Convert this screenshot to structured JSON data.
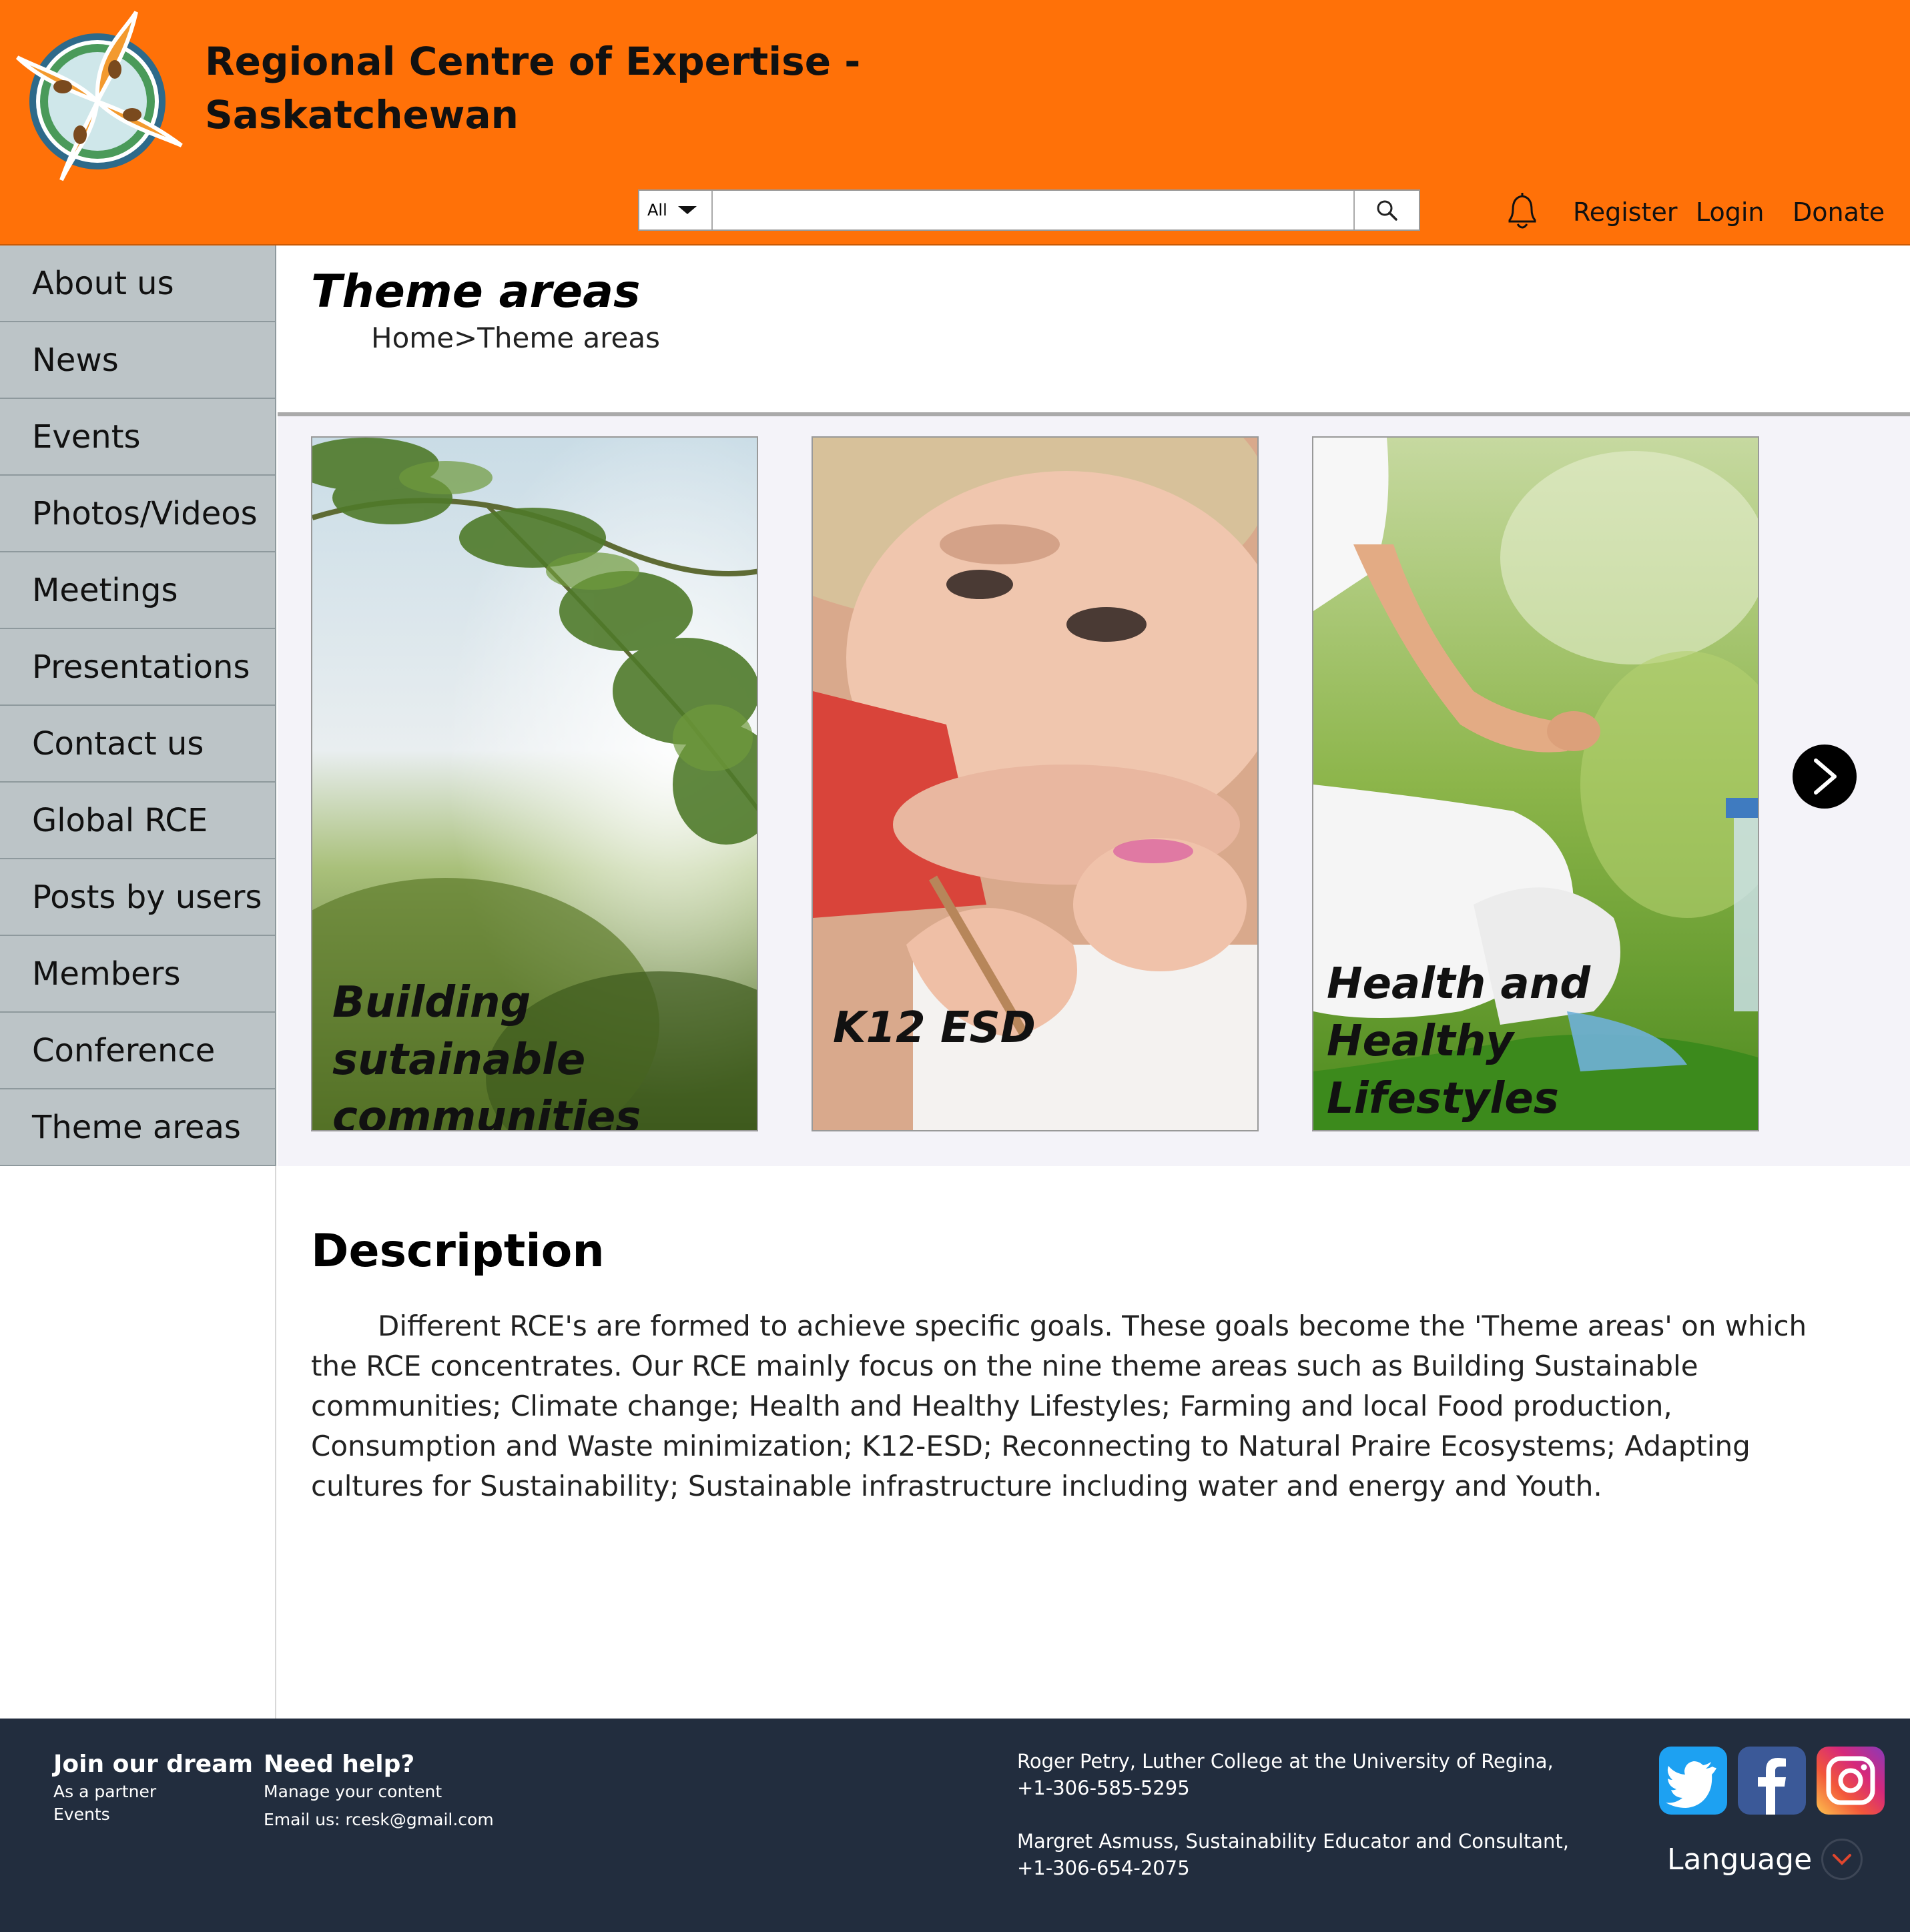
{
  "header": {
    "title_line1": "Regional Centre of Expertise -",
    "title_line2": "Saskatchewan",
    "search": {
      "scope": "All",
      "placeholder": ""
    },
    "links": {
      "register": "Register",
      "login": "Login",
      "donate": "Donate"
    }
  },
  "sidebar": {
    "items": [
      {
        "label": "About us"
      },
      {
        "label": "News"
      },
      {
        "label": "Events"
      },
      {
        "label": "Photos/Videos"
      },
      {
        "label": "Meetings"
      },
      {
        "label": "Presentations"
      },
      {
        "label": "Contact us"
      },
      {
        "label": "Global RCE"
      },
      {
        "label": "Posts by users"
      },
      {
        "label": "Members"
      },
      {
        "label": "Conference"
      },
      {
        "label": "Theme areas"
      }
    ]
  },
  "main": {
    "title": "Theme areas",
    "breadcrumb": "Home>Theme areas",
    "cards": [
      {
        "line1": "Building sutainable",
        "line2": "communities"
      },
      {
        "line1": "K12 ESD",
        "line2": ""
      },
      {
        "line1": "Health and Healthy",
        "line2": "Lifestyles"
      }
    ],
    "description_heading": "Description",
    "description_text": "Different RCE's are formed to achieve specific goals. These goals become the 'Theme areas' on which the RCE concentrates. Our RCE mainly focus on the nine theme areas such as Building Sustainable communities; Climate change; Health and Healthy Lifestyles; Farming and local Food production, Consumption and Waste minimization; K12-ESD; Reconnecting to Natural Praire Ecosystems; Adapting cultures for Sustainability; Sustainable infrastructure including water and energy and Youth."
  },
  "footer": {
    "join": {
      "heading": "Join our dream",
      "line1": "As a partner",
      "line2": "Events"
    },
    "help": {
      "heading": "Need help?",
      "line1": "Manage your content",
      "line2": "Email us: rcesk@gmail.com"
    },
    "contacts": {
      "c1_name": "Roger Petry, Luther College at the University of Regina,",
      "c1_phone": "+1-306-585-5295",
      "c2_name": "Margret Asmuss, Sustainability Educator and Consultant,",
      "c2_phone": "+1-306-654-2075"
    },
    "language": "Language"
  },
  "colors": {
    "header_bg": "#ff7108",
    "sidebar_item_bg": "#bcc4c7",
    "gallery_bg": "#f4f3f9",
    "footer_bg": "#222d3e",
    "twitter": "#1da1f2",
    "facebook": "#3b5998"
  },
  "icons": [
    "logo-icon",
    "caret-down-icon",
    "search-icon",
    "bell-icon",
    "chevron-right-icon",
    "twitter-icon",
    "facebook-icon",
    "instagram-icon",
    "chevron-down-icon"
  ]
}
